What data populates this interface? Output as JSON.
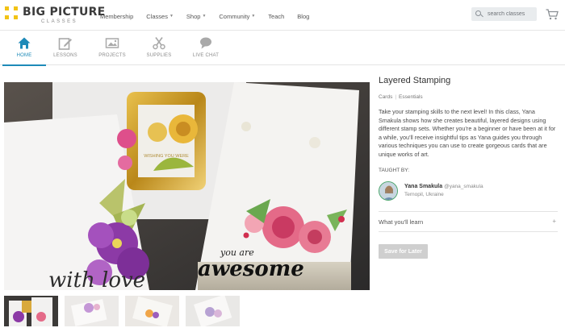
{
  "brand": {
    "name": "BIG PICTURE",
    "sub": "CLASSES",
    "accent": "#f2c315"
  },
  "topnav": [
    {
      "label": "Membership",
      "caret": false
    },
    {
      "label": "Classes",
      "caret": true
    },
    {
      "label": "Shop",
      "caret": true
    },
    {
      "label": "Community",
      "caret": true
    },
    {
      "label": "Teach",
      "caret": false
    },
    {
      "label": "Blog",
      "caret": false
    }
  ],
  "search": {
    "placeholder": "search classes",
    "value": ""
  },
  "icons": {
    "search": "search-icon",
    "cart": "cart-icon"
  },
  "subnav": {
    "active_color": "#1e8ab8",
    "items": [
      {
        "label": "HOME",
        "icon": "home-icon",
        "active": true
      },
      {
        "label": "LESSONS",
        "icon": "pencil-icon",
        "active": false
      },
      {
        "label": "PROJECTS",
        "icon": "image-icon",
        "active": false
      },
      {
        "label": "SUPPLIES",
        "icon": "scissors-icon",
        "active": false
      },
      {
        "label": "LIVE CHAT",
        "icon": "chat-icon",
        "active": false
      }
    ]
  },
  "course": {
    "title": "Layered Stamping",
    "tags": [
      "Cards",
      "Essentials"
    ],
    "description": "Take your stamping skills to the next level! In this class, Yana Smakula shows how she creates beautiful, layered designs using different stamp sets. Whether you’re a beginner or have been at it for a while, you’ll receive insightful tips as Yana guides you through various techniques you can use to create gorgeous cards that are unique works of art.",
    "taught_by_label": "TAUGHT BY:",
    "instructor": {
      "name": "Yana Smakula",
      "handle": "@yana_smakula",
      "location": "Ternopil, Ukraine"
    },
    "learn_label": "What you'll learn",
    "learn_toggle": "+",
    "save_label": "Save for Later"
  },
  "hero": {
    "card_text_1": "you are",
    "card_text_2": "awesome",
    "card_text_3": "with love",
    "frame_text": "WISHING YOU WERE"
  }
}
